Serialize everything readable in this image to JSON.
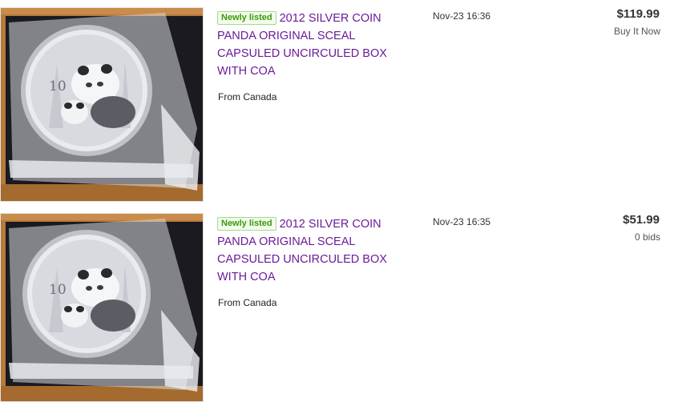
{
  "listings": [
    {
      "badge": "Newly listed",
      "title": "2012 SILVER COIN PANDA ORIGINAL SCEAL CAPSULED UNCIRCULED BOX WITH COA",
      "origin": "From Canada",
      "time": "Nov-23 16:36",
      "price": "$119.99",
      "format": "Buy It Now",
      "coin_denomination": "10"
    },
    {
      "badge": "Newly listed",
      "title": "2012 SILVER COIN PANDA ORIGINAL SCEAL CAPSULED UNCIRCULED BOX WITH COA",
      "origin": "From Canada",
      "time": "Nov-23 16:35",
      "price": "$51.99",
      "format": "0 bids",
      "coin_denomination": "10"
    }
  ],
  "colors": {
    "title_link": "#6a1b9a",
    "badge_green": "#3a9a06",
    "box_wood": "#b57a3c",
    "box_dark": "#1a1a20"
  }
}
